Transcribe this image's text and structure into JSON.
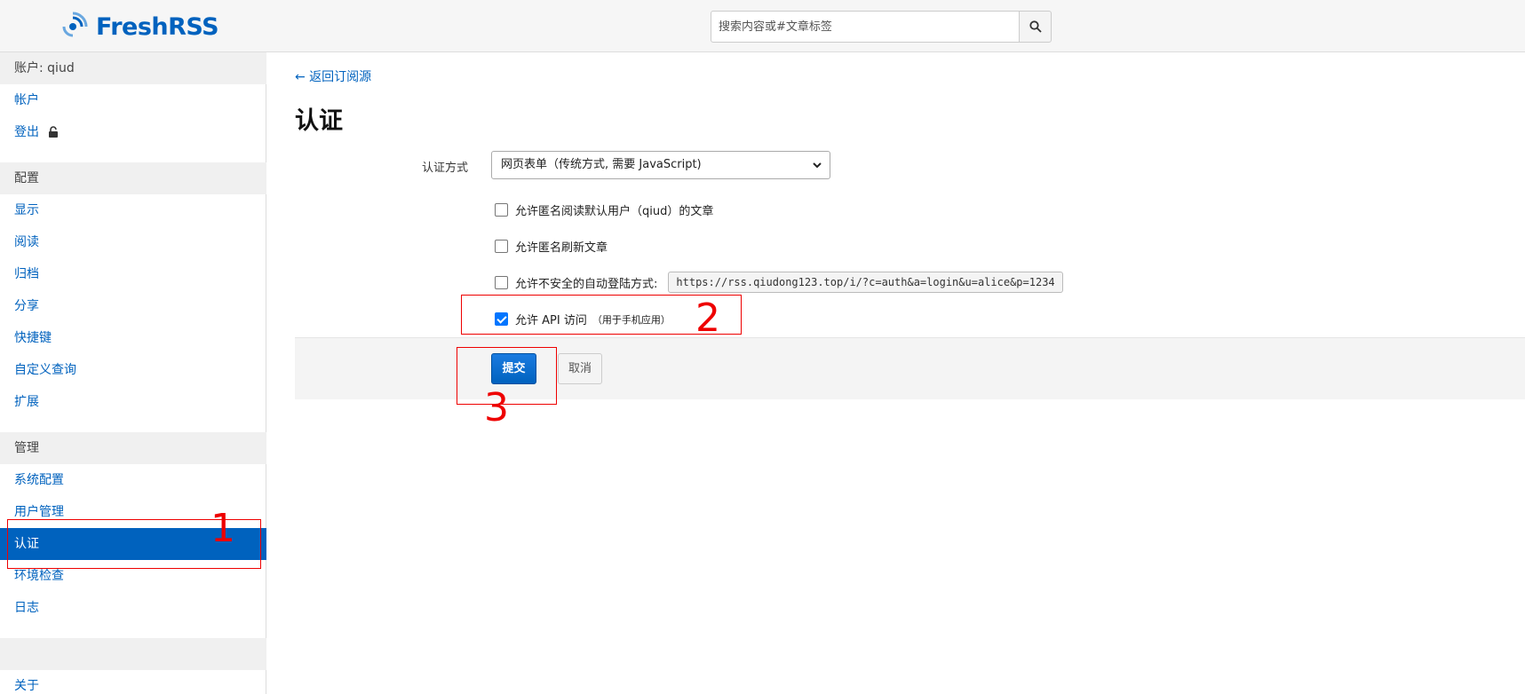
{
  "header": {
    "app_name": "FreshRSS",
    "search_placeholder": "搜索内容或#文章标签"
  },
  "sidebar": {
    "account_section": "账户: qiud",
    "account_items": [
      "帐户",
      "登出"
    ],
    "config_section": "配置",
    "config_items": [
      "显示",
      "阅读",
      "归档",
      "分享",
      "快捷键",
      "自定义查询",
      "扩展"
    ],
    "admin_section": "管理",
    "admin_items": [
      "系统配置",
      "用户管理",
      "认证",
      "环境检查",
      "日志"
    ],
    "active_item": "认证",
    "about": "关于"
  },
  "main": {
    "back_link": "← 返回订阅源",
    "title": "认证",
    "auth_method_label": "认证方式",
    "auth_method_value": "网页表单（传统方式, 需要 JavaScript)",
    "checkboxes": [
      {
        "label": "允许匿名阅读默认用户（qiud）的文章",
        "checked": false
      },
      {
        "label": "允许匿名刷新文章",
        "checked": false
      },
      {
        "label": "允许不安全的自动登陆方式:",
        "checked": false,
        "url": "https://rss.qiudong123.top/i/?c=auth&a=login&u=alice&p=1234"
      },
      {
        "label": "允许 API 访问",
        "hint": "（用于手机应用）",
        "checked": true
      }
    ],
    "submit": "提交",
    "cancel": "取消"
  },
  "annotations": [
    "1",
    "2",
    "3"
  ]
}
